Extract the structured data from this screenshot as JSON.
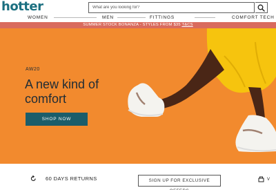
{
  "header": {
    "logo_text": "hotter",
    "search_placeholder": "What are you looking for?",
    "search_icon": "search-icon"
  },
  "nav": {
    "items": [
      "WOMEN",
      "MEN",
      "FITTINGS",
      "COMFORT TECH"
    ]
  },
  "promo": {
    "text": "SUMMER STOCK BONANZA - STYLES FROM $35 ",
    "link": "T&CS"
  },
  "hero": {
    "subtitle": "AW20",
    "title": "A new kind of comfort",
    "button_label": "SHOP NOW",
    "colors": {
      "background": "#f28a2e",
      "button": "#1b5d6a",
      "title": "#1f2c35",
      "promo_bar": "#d96b5e",
      "brand": "#1b6f80"
    }
  },
  "bottom": {
    "returns_icon": "returns-arrow-icon",
    "returns_label": "60 DAYS RETURNS",
    "signup_label": "SIGN UP FOR EXCLUSIVE OFFERS",
    "widget_icon": "widget-icon",
    "widget_label": "V"
  }
}
